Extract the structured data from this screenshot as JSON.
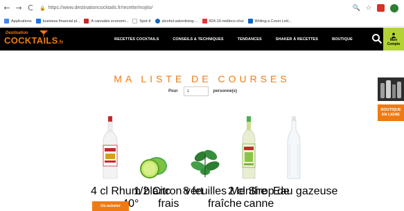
{
  "browser": {
    "url": "https://www.destinationcocktails.fr/recette/mojito/",
    "bookmarks": [
      {
        "label": "Applications",
        "color": "#4285f4"
      },
      {
        "label": "business financial pl...",
        "color": "#1a73e8"
      },
      {
        "label": "A cannabis economi...",
        "color": "#c62828"
      },
      {
        "label": "Spot-It",
        "color": "#bbbbbb"
      },
      {
        "label": "alcohol-advertising-...",
        "color": "#1565c0"
      },
      {
        "label": "824-16-midleco-chui",
        "color": "#e53935"
      },
      {
        "label": "Writing a Cover Lett...",
        "color": "#0a66c2"
      }
    ]
  },
  "site": {
    "logo_top": "Destination",
    "logo_main": "COCKTAILS",
    "logo_suffix": ".fr",
    "menu": [
      "RECETTES COCKTAILS",
      "CONSEILS & TECHNIQUES",
      "TENDANCES",
      "SHAKER À RECETTES",
      "BOUTIQUE"
    ],
    "account_label_1": "Mon",
    "account_label_2": "Compte"
  },
  "page": {
    "title": "MA LISTE DE COURSES",
    "pour_label": "Pour",
    "persons_value": "1",
    "persons_label": "personne(s)",
    "buy_button": "Où acheter",
    "boutique_line1": "BOUTIQUE",
    "boutique_line2": "EN LIGNE"
  },
  "products": [
    {
      "caption_1": "4 cl Rhum blanc",
      "caption_2": "40°"
    },
    {
      "caption_1": "1/2 Citron vert",
      "caption_2": "frais"
    },
    {
      "caption_1": "8 feuilles Menthe",
      "caption_2": "fraîche"
    },
    {
      "caption_1": "2 cl Sirop de",
      "caption_2": "canne"
    },
    {
      "caption_1": "Eau gazeuse",
      "caption_2": ""
    }
  ],
  "colors": {
    "accent": "#f07a12",
    "account": "#b3d335",
    "header": "#000000"
  }
}
